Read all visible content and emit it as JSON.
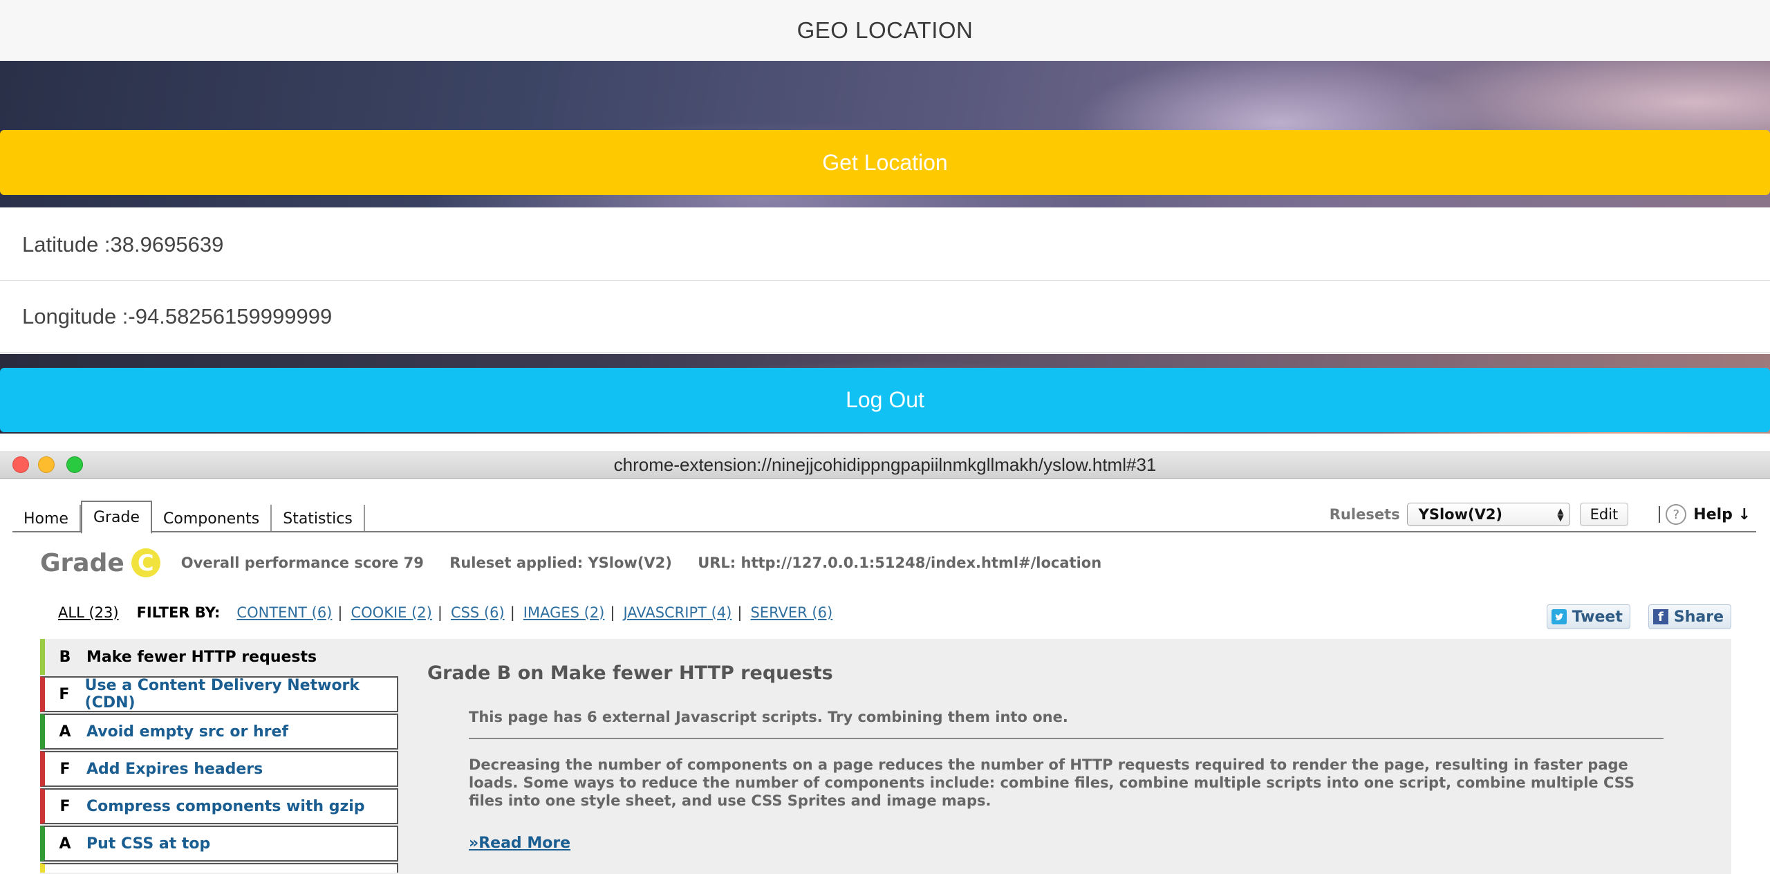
{
  "app": {
    "title": "GEO LOCATION",
    "get_location_label": "Get Location",
    "latitude_text": "Latitude :38.9695639",
    "longitude_text": "Longitude :-94.58256159999999",
    "logout_label": "Log Out",
    "colors": {
      "get_location": "#ffc900",
      "logout": "#11c1f3"
    }
  },
  "window": {
    "url": "chrome-extension://ninejjcohidippngpapiilnmkgllmakh/yslow.html#31"
  },
  "yslow": {
    "tabs": [
      {
        "label": "Home"
      },
      {
        "label": "Grade"
      },
      {
        "label": "Components"
      },
      {
        "label": "Statistics"
      }
    ],
    "rulesets_label": "Rulesets",
    "ruleset_selected": "YSlow(V2)",
    "edit_label": "Edit",
    "help_icon": "?",
    "help_label": "Help ↓",
    "grade_word": "Grade",
    "grade_letter": "C",
    "score_text": "Overall performance score 79",
    "ruleset_text": "Ruleset applied: YSlow(V2)",
    "url_text": "URL: http://127.0.0.1:51248/index.html#/location",
    "filter_all": "ALL (23)",
    "filter_by": "FILTER BY:",
    "filters": [
      "CONTENT (6)",
      "COOKIE (2)",
      "CSS (6)",
      "IMAGES (2)",
      "JAVASCRIPT (4)",
      "SERVER (6)"
    ],
    "tweet_label": "Tweet",
    "share_label": "Share",
    "rules": [
      {
        "grade": "B",
        "label": "Make fewer HTTP requests"
      },
      {
        "grade": "F",
        "label": "Use a Content Delivery Network (CDN)"
      },
      {
        "grade": "A",
        "label": "Avoid empty src or href"
      },
      {
        "grade": "F",
        "label": "Add Expires headers"
      },
      {
        "grade": "F",
        "label": "Compress components with gzip"
      },
      {
        "grade": "A",
        "label": "Put CSS at top"
      }
    ],
    "detail": {
      "title": "Grade B on Make fewer HTTP requests",
      "message": "This page has 6 external Javascript scripts. Try combining them into one.",
      "description": "Decreasing the number of components on a page reduces the number of HTTP requests required to render the page, resulting in faster page loads. Some ways to reduce the number of components include: combine files, combine multiple scripts into one script, combine multiple CSS files into one style sheet, and use CSS Sprites and image maps.",
      "read_more": "»Read More"
    }
  }
}
